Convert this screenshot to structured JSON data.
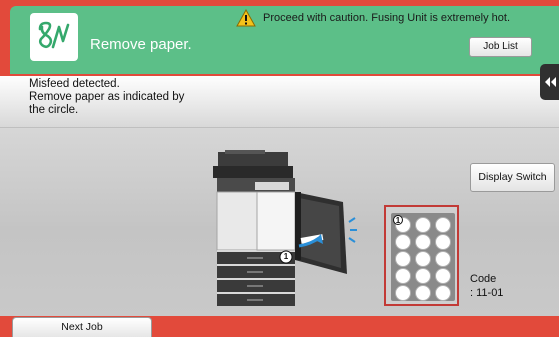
{
  "header": {
    "title": "Remove paper.",
    "status_icon": "paper-misfeed-icon",
    "warning_icon": "warning-triangle-icon",
    "warning_text": "Proceed with caution. Fusing Unit is extremely hot.",
    "job_list_label": "Job List"
  },
  "message": {
    "lines": [
      "Misfeed detected.",
      "Remove paper as indicated by",
      "the circle."
    ]
  },
  "side_panel": {
    "icon": "collapse-left-icon"
  },
  "illustration": {
    "machine_icon": "mfp-printer-icon",
    "location_number": "1"
  },
  "tray_diagram": {
    "marker_number": "1",
    "rows": 5,
    "columns": 3
  },
  "display_switch_label": "Display Switch",
  "code": {
    "label": "Code",
    "value": ": 11-01"
  },
  "footer": {
    "next_job_label": "Next Job"
  },
  "colors": {
    "frame_red": "#e24a3b",
    "header_green": "#5cbf88",
    "highlight_red": "#c23a36",
    "warning_yellow": "#f4c21b"
  }
}
